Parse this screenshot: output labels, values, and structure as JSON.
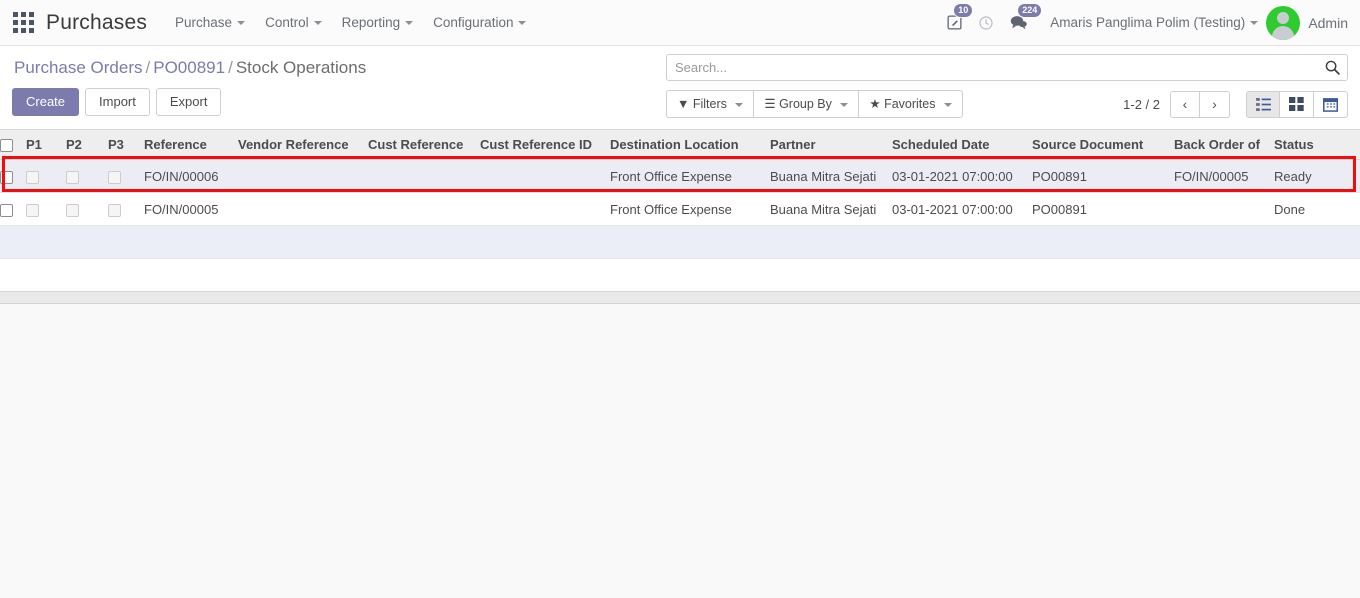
{
  "navbar": {
    "apps_icon": "apps-grid-icon",
    "brand": "Purchases",
    "menus": [
      {
        "label": "Purchase"
      },
      {
        "label": "Control"
      },
      {
        "label": "Reporting"
      },
      {
        "label": "Configuration"
      }
    ],
    "sys_icons": [
      {
        "name": "activity-edit-icon",
        "badge": "10"
      },
      {
        "name": "clock-icon",
        "badge": ""
      },
      {
        "name": "messages-icon",
        "badge": "224"
      }
    ],
    "company": "Amaris Panglima Polim (Testing)",
    "user": "Admin"
  },
  "control_panel": {
    "breadcrumb": {
      "root": "Purchase Orders",
      "sep": "/",
      "parent": "PO00891",
      "current": "Stock Operations"
    },
    "buttons": {
      "create": "Create",
      "import": "Import",
      "export": "Export"
    },
    "search": {
      "placeholder": "Search...",
      "value": "",
      "icon": "search-icon"
    },
    "filters": {
      "filters": "Filters",
      "group_by": "Group By",
      "favorites": "Favorites"
    },
    "pager": {
      "count": "1-2 / 2",
      "prev": "‹",
      "next": "›"
    },
    "views": [
      {
        "name": "list-view",
        "active": true
      },
      {
        "name": "kanban-view",
        "active": false
      },
      {
        "name": "calendar-view",
        "active": false
      }
    ]
  },
  "table": {
    "columns": [
      "P1",
      "P2",
      "P3",
      "Reference",
      "Vendor Reference",
      "Cust Reference",
      "Cust Reference ID",
      "Destination Location",
      "Partner",
      "Scheduled Date",
      "Source Document",
      "Back Order of",
      "Status"
    ],
    "rows": [
      {
        "reference": "FO/IN/00006",
        "vendor_reference": "",
        "cust_reference": "",
        "cust_reference_id": "",
        "destination_location": "Front Office Expense",
        "partner": "Buana Mitra Sejati",
        "scheduled_date": "03-01-2021 07:00:00",
        "source_document": "PO00891",
        "back_order_of": "FO/IN/00005",
        "status": "Ready",
        "selected": true
      },
      {
        "reference": "FO/IN/00005",
        "vendor_reference": "",
        "cust_reference": "",
        "cust_reference_id": "",
        "destination_location": "Front Office Expense",
        "partner": "Buana Mitra Sejati",
        "scheduled_date": "03-01-2021 07:00:00",
        "source_document": "PO00891",
        "back_order_of": "",
        "status": "Done",
        "selected": false
      }
    ]
  },
  "colors": {
    "accent": "#7c7bad",
    "highlight_box": "#f30c0c",
    "selected_row": "#eceef7",
    "avatar": "#2ecc2e"
  }
}
